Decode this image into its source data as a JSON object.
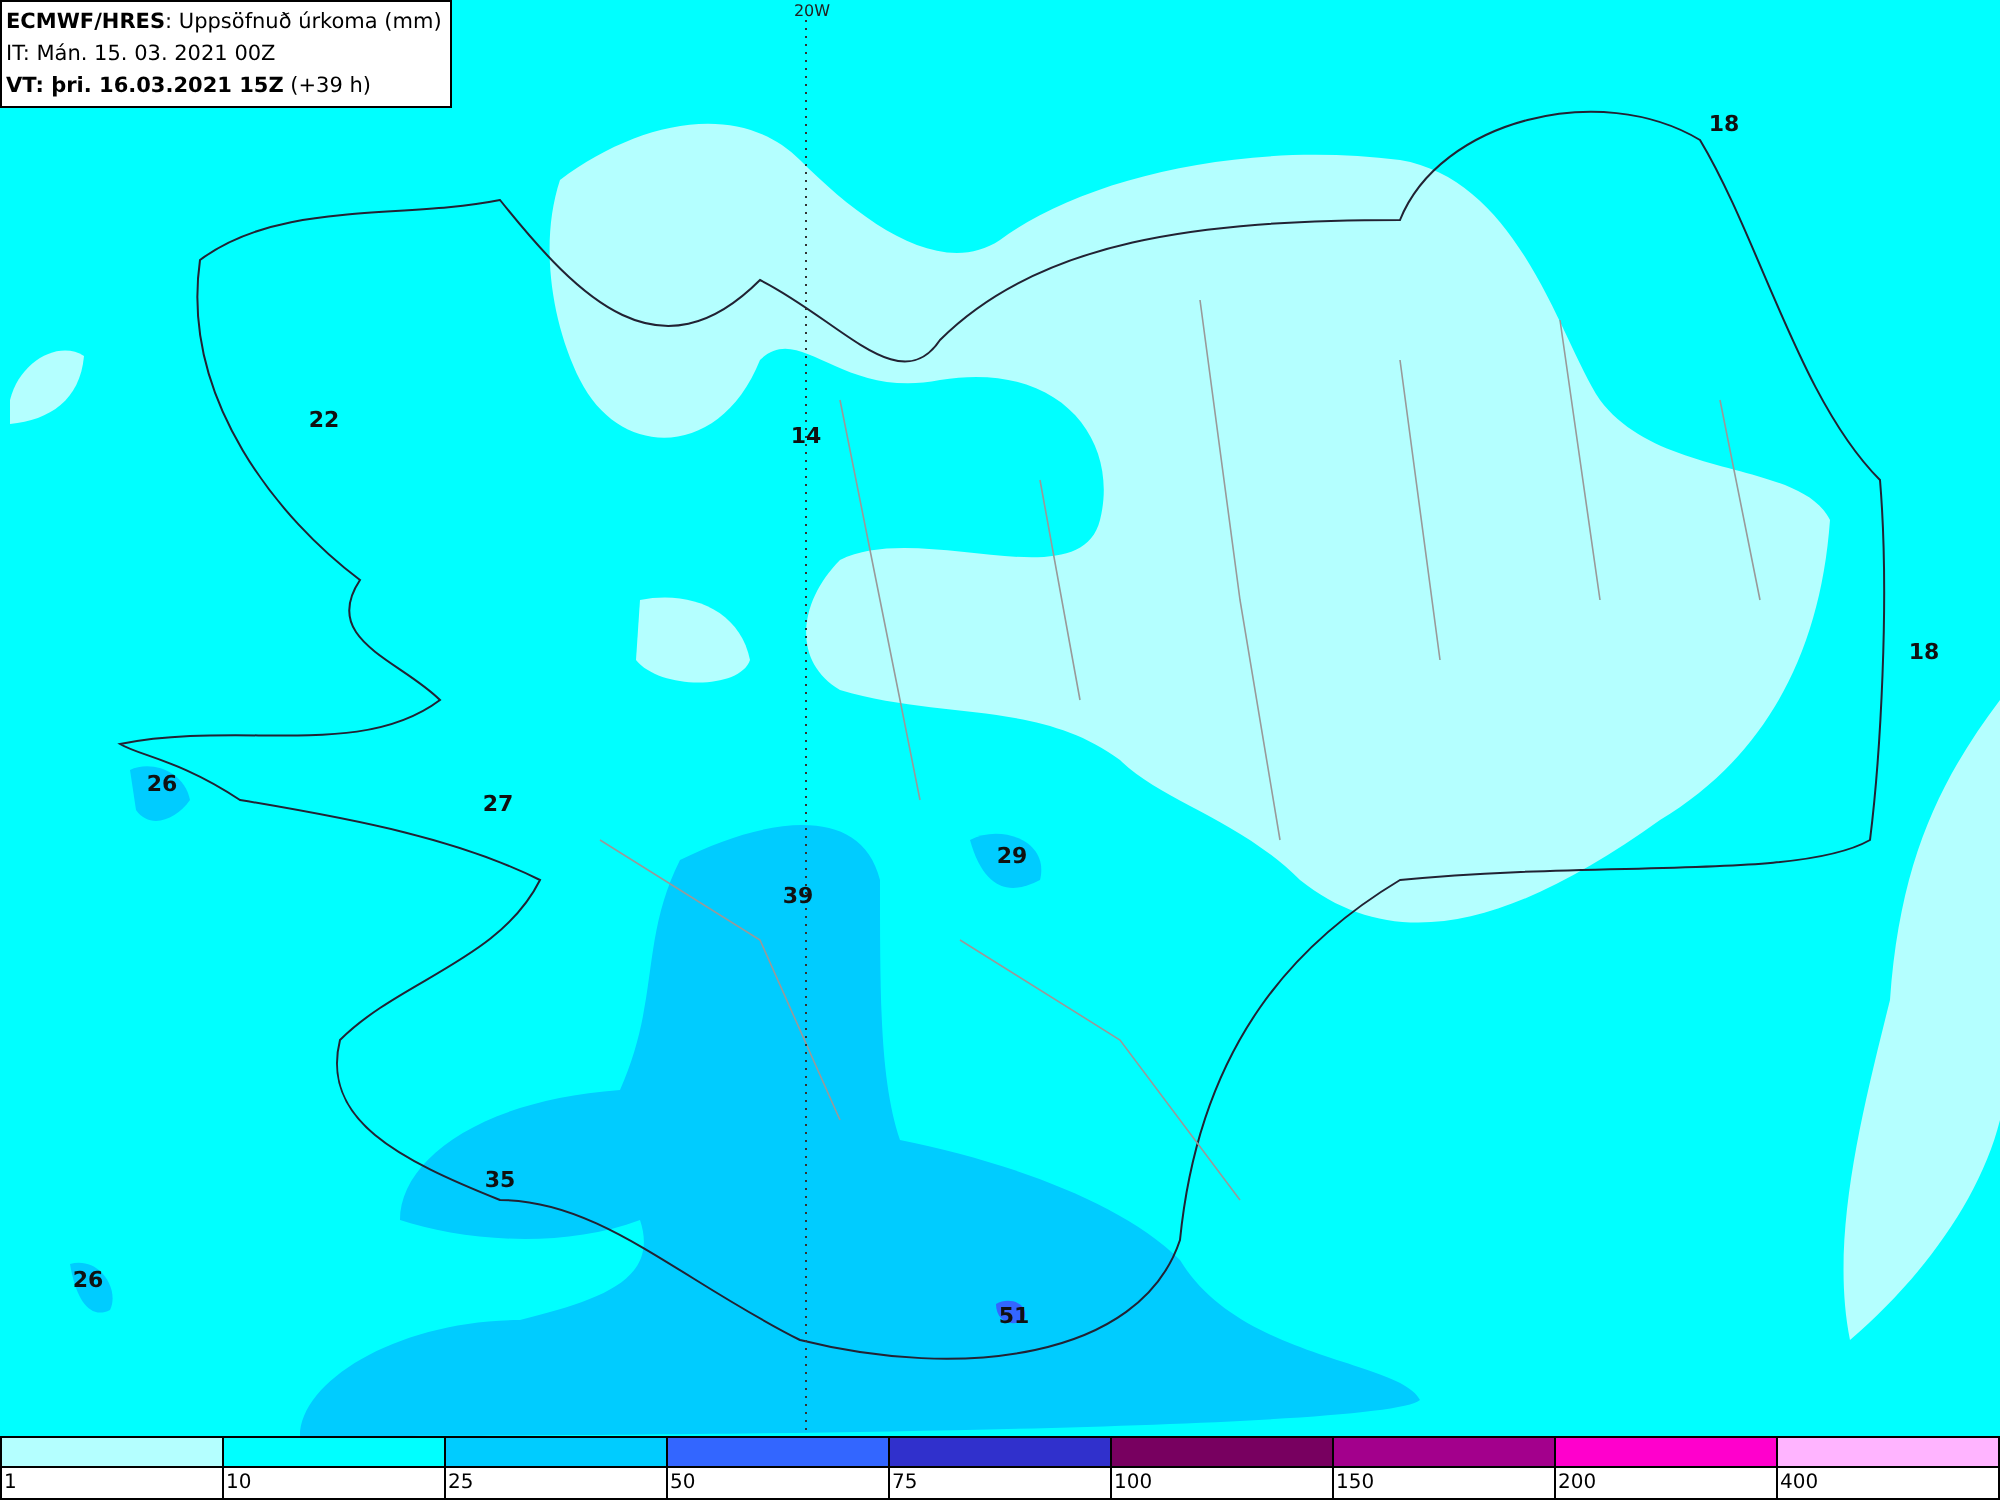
{
  "header": {
    "model": "ECMWF/HRES",
    "product": ": Uppsöfnuð úrkoma (mm)",
    "issue_time": "IT: Mán. 15. 03. 2021 00Z",
    "valid_time": "VT: þri. 16.03.2021 15Z",
    "lead": " (+39 h)"
  },
  "meridian_label": "20W",
  "values": [
    {
      "text": "18"
    },
    {
      "text": "22"
    },
    {
      "text": "14"
    },
    {
      "text": "18"
    },
    {
      "text": "26"
    },
    {
      "text": "27"
    },
    {
      "text": "29"
    },
    {
      "text": "39"
    },
    {
      "text": "35"
    },
    {
      "text": "26"
    },
    {
      "text": "51"
    }
  ],
  "legend": [
    {
      "label": "1",
      "color": "#b4ffff"
    },
    {
      "label": "10",
      "color": "#00ffff"
    },
    {
      "label": "25",
      "color": "#00ccff"
    },
    {
      "label": "50",
      "color": "#3366ff"
    },
    {
      "label": "75",
      "color": "#3030cc"
    },
    {
      "label": "100",
      "color": "#780060"
    },
    {
      "label": "150",
      "color": "#a3008c"
    },
    {
      "label": "200",
      "color": "#ff00cc"
    },
    {
      "label": "400",
      "color": "#ffb4ff"
    }
  ]
}
